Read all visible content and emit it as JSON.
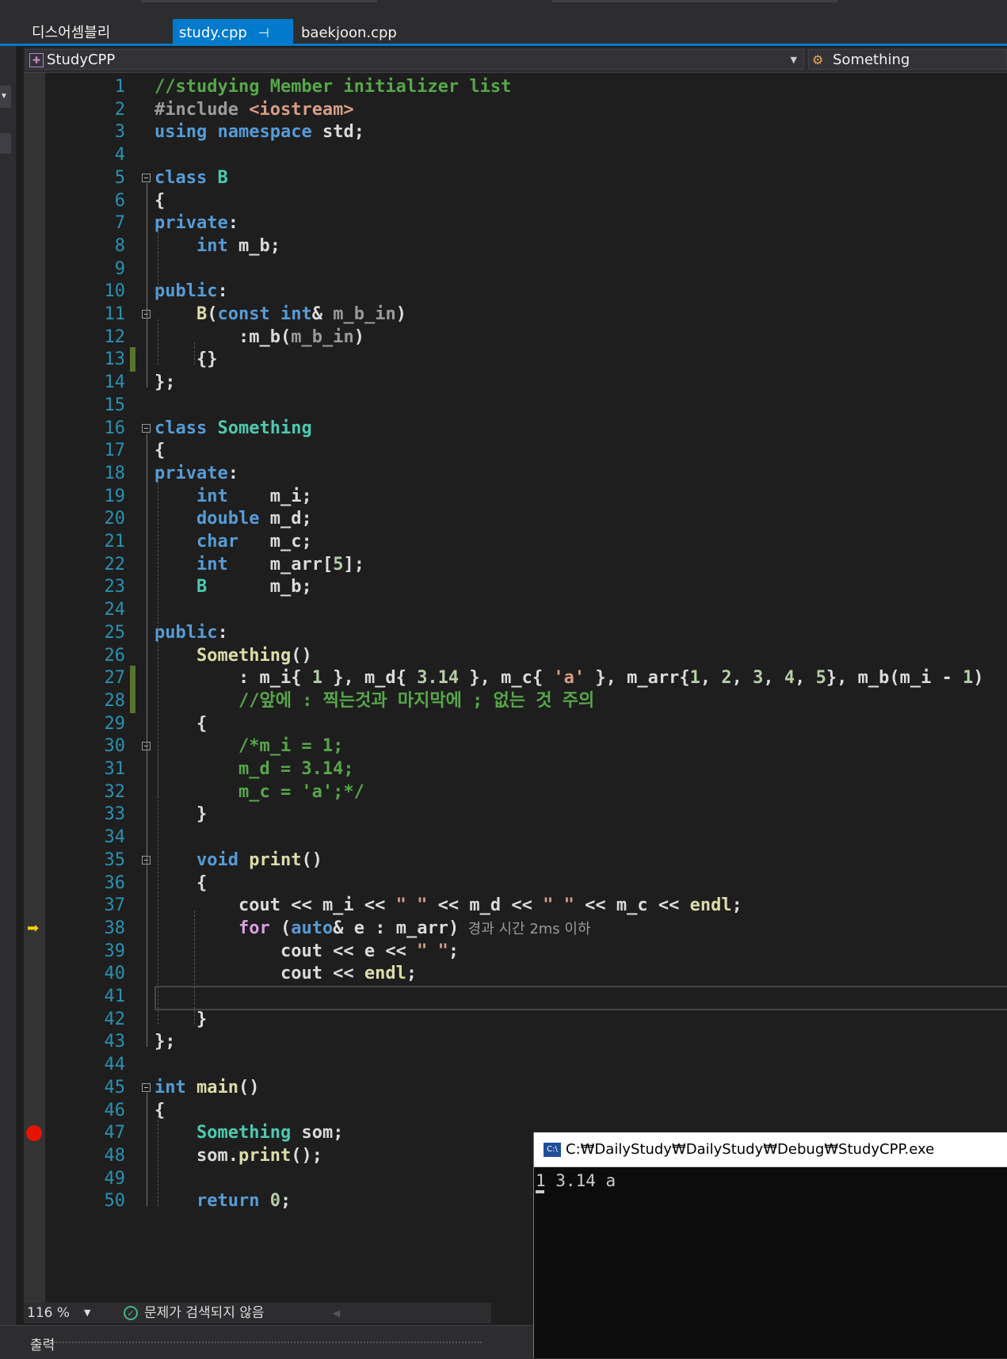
{
  "tabs": [
    {
      "label": "디스어셈블리"
    },
    {
      "label": "study.cpp"
    },
    {
      "label": "baekjoon.cpp"
    }
  ],
  "nav": {
    "project": "StudyCPP",
    "scope": "Something"
  },
  "status": {
    "zoom": "116 %",
    "issues": "문제가 검색되지 않음"
  },
  "output_panel": {
    "label": "출력"
  },
  "console": {
    "title": "C:₩DailyStudy₩DailyStudy₩Debug₩StudyCPP.exe",
    "lines": [
      "1 3.14 a"
    ]
  },
  "editor": {
    "current_line": 38,
    "breakpoint_line": 47,
    "perf_tip": "경과 시간 2ms 이하",
    "line_numbers": [
      "1",
      "2",
      "3",
      "4",
      "5",
      "6",
      "7",
      "8",
      "9",
      "10",
      "11",
      "12",
      "13",
      "14",
      "15",
      "16",
      "17",
      "18",
      "19",
      "20",
      "21",
      "22",
      "23",
      "24",
      "25",
      "26",
      "27",
      "28",
      "29",
      "30",
      "31",
      "32",
      "33",
      "34",
      "35",
      "36",
      "37",
      "38",
      "39",
      "40",
      "41",
      "42",
      "43",
      "44",
      "45",
      "46",
      "47",
      "48",
      "49",
      "50"
    ],
    "lines": [
      "//studying Member initializer list",
      "#include <iostream>",
      "using namespace std;",
      "",
      "class B",
      "{",
      "private:",
      "    int m_b;",
      "",
      "public:",
      "    B(const int& m_b_in)",
      "        :m_b(m_b_in)",
      "    {}",
      "};",
      "",
      "class Something",
      "{",
      "private:",
      "    int    m_i;",
      "    double m_d;",
      "    char   m_c;",
      "    int    m_arr[5];",
      "    B      m_b;",
      "",
      "public:",
      "    Something()",
      "        : m_i{ 1 }, m_d{ 3.14 }, m_c{ 'a' }, m_arr{1, 2, 3, 4, 5}, m_b(m_i - 1)",
      "        //앞에 : 찍는것과 마지막에 ; 없는 것 주의",
      "    {",
      "        /*m_i = 1;",
      "        m_d = 3.14;",
      "        m_c = 'a';*/",
      "    }",
      "",
      "    void print()",
      "    {",
      "        cout << m_i << \" \" << m_d << \" \" << m_c << endl;",
      "        for (auto& e : m_arr)",
      "            cout << e << \" \";",
      "            cout << endl;",
      "",
      "    }",
      "};",
      "",
      "int main()",
      "{",
      "    Something som;",
      "    som.print();",
      "",
      "    return 0;"
    ]
  }
}
